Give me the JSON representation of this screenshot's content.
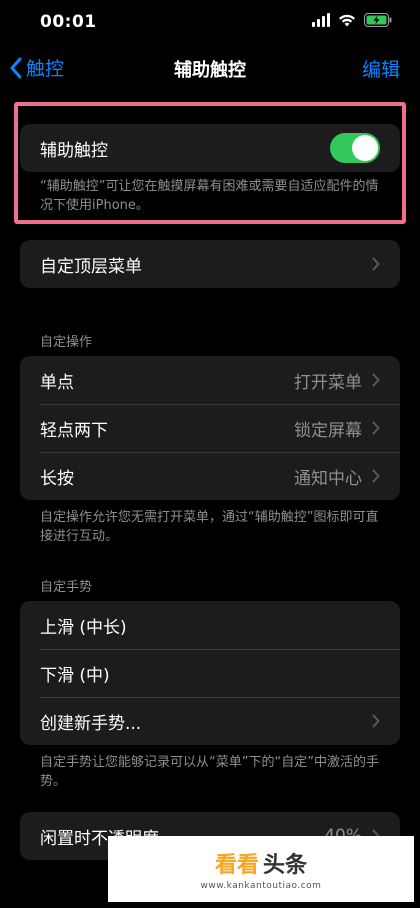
{
  "status": {
    "time": "00:01"
  },
  "nav": {
    "back_label": "触控",
    "title": "辅助触控",
    "edit_label": "编辑"
  },
  "assistive": {
    "label": "辅助触控",
    "enabled": true,
    "description": "“辅助触控”可让您在触摸屏幕有困难或需要自适应配件的情况下使用iPhone。"
  },
  "top_menu": {
    "label": "自定顶层菜单"
  },
  "custom_actions": {
    "header": "自定操作",
    "rows": [
      {
        "label": "单点",
        "value": "打开菜单"
      },
      {
        "label": "轻点两下",
        "value": "锁定屏幕"
      },
      {
        "label": "长按",
        "value": "通知中心"
      }
    ],
    "footer": "自定操作允许您无需打开菜单，通过“辅助触控”图标即可直接进行互动。"
  },
  "custom_gestures": {
    "header": "自定手势",
    "rows": [
      {
        "label": "上滑 (中长)"
      },
      {
        "label": "下滑 (中)"
      },
      {
        "label": "创建新手势..."
      }
    ],
    "footer": "自定手势让您能够记录可以从“菜单”下的“自定”中激活的手势。"
  },
  "idle_opacity": {
    "label": "闲置时不透明度",
    "value": "40%"
  },
  "watermark": {
    "main_1": "看看",
    "main_2": "头条",
    "url": "www.kankantoutiao.com"
  },
  "colors": {
    "accent": "#0a84ff",
    "toggle_on": "#34c759",
    "highlight": "#ef6f8f"
  }
}
